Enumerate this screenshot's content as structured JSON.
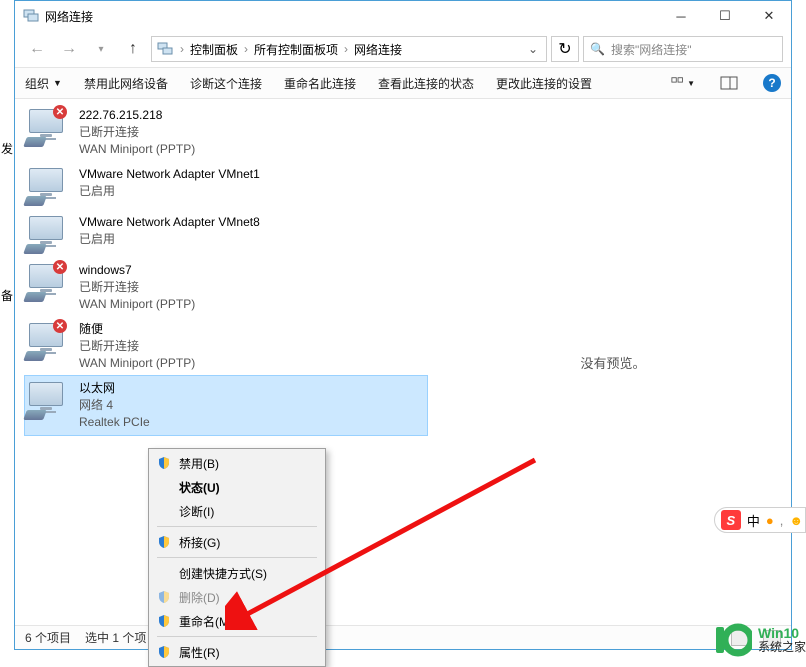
{
  "window": {
    "title": "网络连接"
  },
  "nav": {
    "breadcrumbs": [
      "控制面板",
      "所有控制面板项",
      "网络连接"
    ],
    "search_placeholder": "搜索\"网络连接\""
  },
  "toolbar": {
    "organize": "组织",
    "disable": "禁用此网络设备",
    "diagnose": "诊断这个连接",
    "rename": "重命名此连接",
    "status": "查看此连接的状态",
    "settings": "更改此连接的设置"
  },
  "connections": [
    {
      "name": "222.76.215.218",
      "status": "已断开连接",
      "device": "WAN Miniport (PPTP)",
      "disconnected": true
    },
    {
      "name": "VMware Network Adapter VMnet1",
      "status": "已启用",
      "device": "",
      "disconnected": false
    },
    {
      "name": "VMware Network Adapter VMnet8",
      "status": "已启用",
      "device": "",
      "disconnected": false
    },
    {
      "name": "windows7",
      "status": "已断开连接",
      "device": "WAN Miniport (PPTP)",
      "disconnected": true
    },
    {
      "name": "随便",
      "status": "已断开连接",
      "device": "WAN Miniport (PPTP)",
      "disconnected": true
    },
    {
      "name": "以太网",
      "status": "网络 4",
      "device": "Realtek PCIe",
      "disconnected": false,
      "selected": true
    }
  ],
  "preview": {
    "none": "没有预览。"
  },
  "context_menu": {
    "disable": "禁用(B)",
    "status": "状态(U)",
    "diagnose": "诊断(I)",
    "bridge": "桥接(G)",
    "shortcut": "创建快捷方式(S)",
    "delete": "删除(D)",
    "rename": "重命名(M)",
    "properties": "属性(R)"
  },
  "statusbar": {
    "count": "6 个项目",
    "selection": "选中 1 个项"
  },
  "ime": {
    "label": "中",
    "dot": "•",
    "face": "☻"
  },
  "brand": {
    "name": "Win10",
    "sub": "系统之家"
  },
  "left": {
    "t1": "发",
    "t2": "备"
  }
}
